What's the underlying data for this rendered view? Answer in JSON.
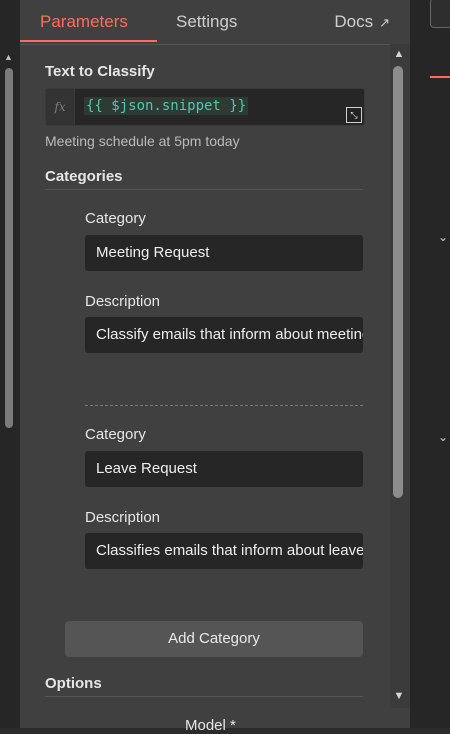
{
  "tabs": {
    "parameters": "Parameters",
    "settings": "Settings",
    "docs": "Docs"
  },
  "text_to_classify": {
    "label": "Text to Classify",
    "fx_label": "fx",
    "expression": "{{ $json.snippet }}",
    "preview": "Meeting schedule at 5pm today"
  },
  "categories": {
    "title": "Categories",
    "items": [
      {
        "category_label": "Category",
        "category_value": "Meeting Request",
        "description_label": "Description",
        "description_value": "Classify emails that inform about meetings"
      },
      {
        "category_label": "Category",
        "category_value": "Leave Request",
        "description_label": "Description",
        "description_value": "Classifies emails that inform about leave"
      }
    ],
    "add_button": "Add Category"
  },
  "options": {
    "title": "Options",
    "model_label": "Model *"
  },
  "colors": {
    "accent": "#ff6d5a",
    "panel_bg": "#404041",
    "input_bg": "#262626",
    "expression_text": "#4ec9b0"
  }
}
